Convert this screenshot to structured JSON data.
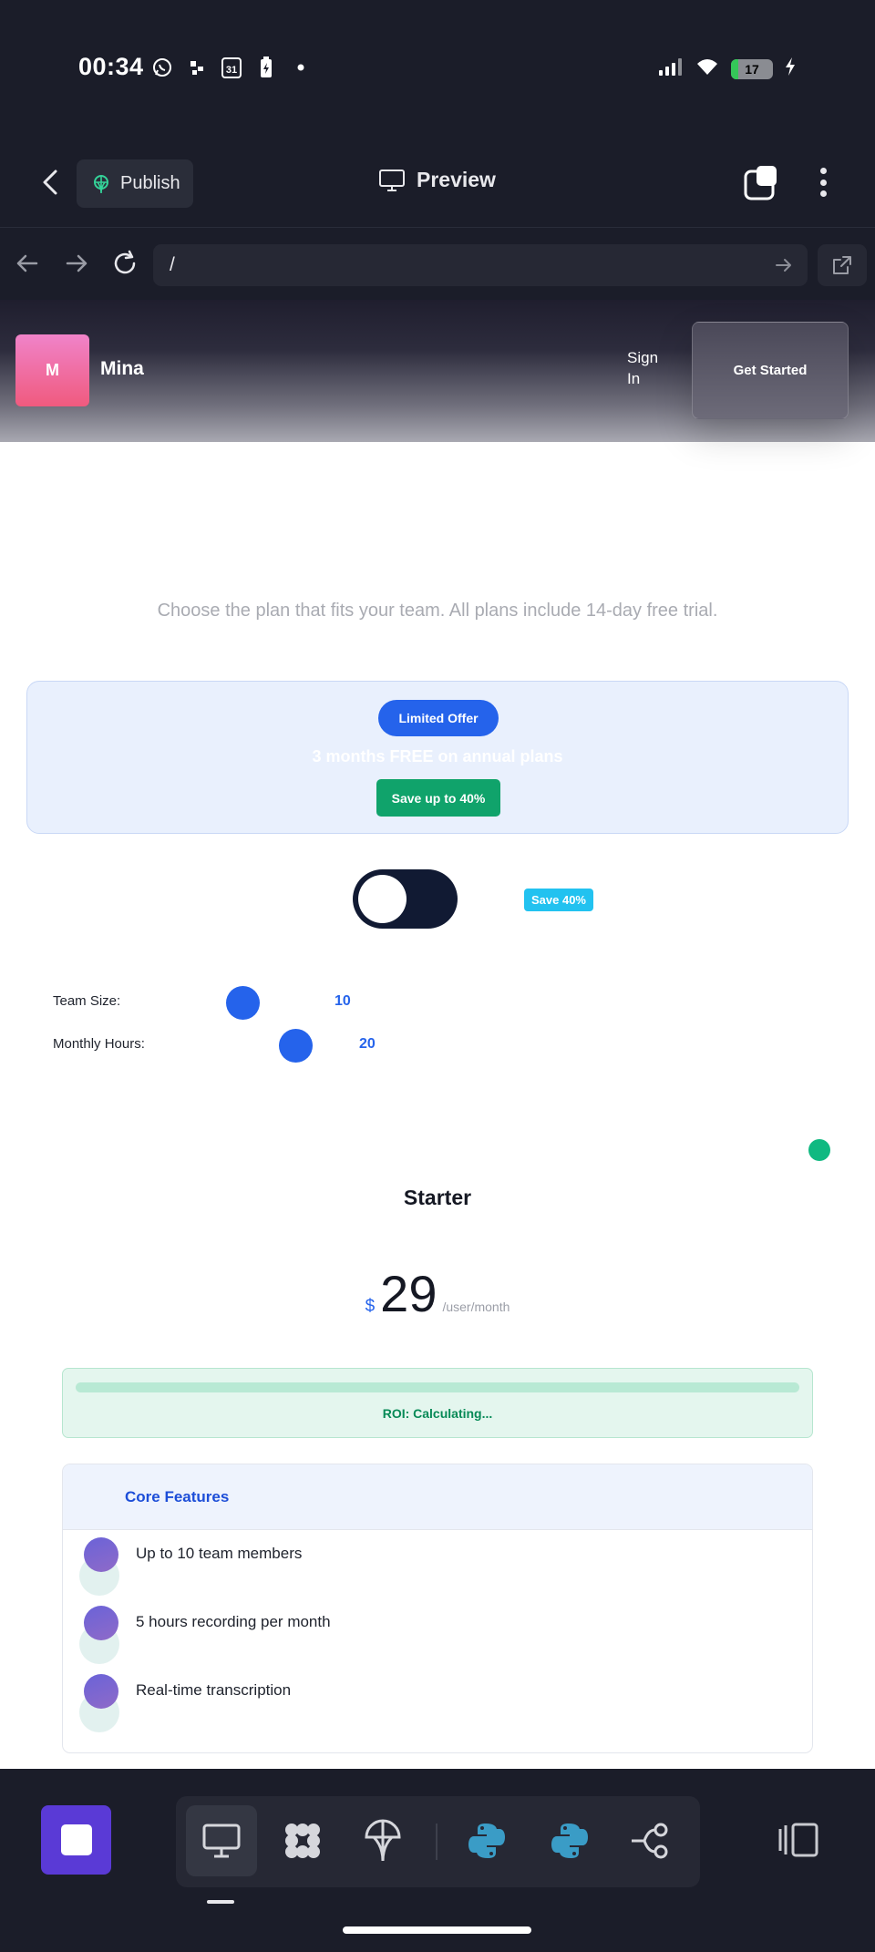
{
  "status_bar": {
    "time": "00:34",
    "calendar_day": "31",
    "battery_level": "17",
    "battery_fraction": 0.17
  },
  "toolbar": {
    "publish_label": "Publish",
    "preview_label": "Preview"
  },
  "url_bar": {
    "value": "/"
  },
  "site": {
    "logo_letter": "M",
    "brand_name": "Mina",
    "signin_label": "Sign In",
    "cta_label": "Get Started"
  },
  "pricing": {
    "subtitle": "Choose the plan that fits your team. All plans include 14-day free trial.",
    "offer": {
      "badge": "Limited Offer",
      "text": "3 months FREE on annual plans",
      "save_label": "Save up to 40%"
    },
    "billing_toggle": {
      "on": false
    },
    "save_pill": "Save 40%",
    "sliders": {
      "team_size_label": "Team Size:",
      "team_size_value": "10",
      "monthly_hours_label": "Monthly Hours:",
      "monthly_hours_value": "20"
    },
    "plan": {
      "name": "Starter",
      "currency": "$",
      "price": "29",
      "period": "/user/month"
    },
    "roi": {
      "label": "ROI: Calculating...",
      "progress": 0
    },
    "features": {
      "title": "Core Features",
      "items": [
        "Up to 10 team members",
        "5 hours recording per month",
        "Real-time transcription"
      ]
    }
  },
  "colors": {
    "accent_blue": "#2563eb",
    "success_green": "#10b981",
    "dock_primary": "#5a3ad6"
  },
  "icons": {
    "status": [
      "whatsapp-icon",
      "qr-icon",
      "calendar-icon",
      "battery-saver-icon",
      "dot-icon",
      "signal-icon",
      "wifi-icon",
      "battery-icon",
      "charging-icon"
    ],
    "dock": [
      "stop-icon",
      "desktop-icon",
      "grid-icon",
      "publish-icon",
      "python-icon",
      "python-icon",
      "workflow-icon",
      "sidebar-icon"
    ]
  }
}
